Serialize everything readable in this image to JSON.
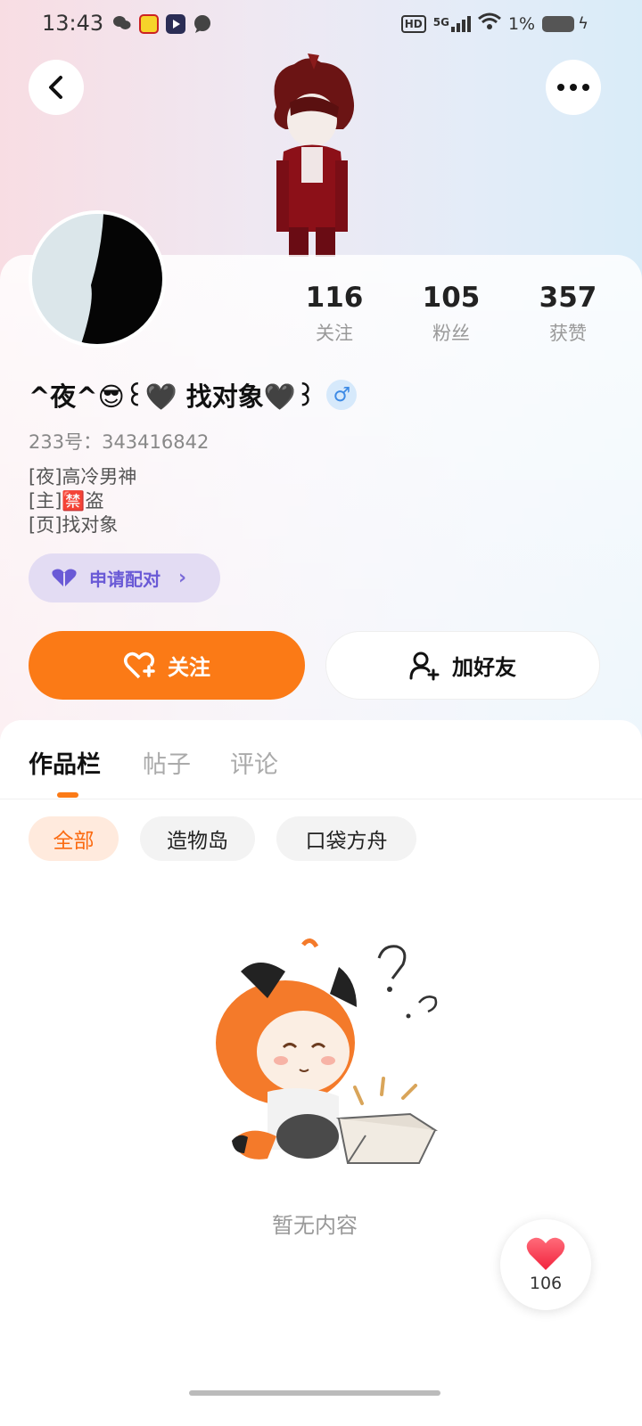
{
  "status_bar": {
    "time": "13:43",
    "network": "5G",
    "hd": "HD",
    "battery": "1%"
  },
  "profile": {
    "stats": [
      {
        "value": "116",
        "label": "关注"
      },
      {
        "value": "105",
        "label": "粉丝"
      },
      {
        "value": "357",
        "label": "获赞"
      }
    ],
    "nickname": "^夜^😎꒰🖤 找对象🖤꒱",
    "gender": "♂",
    "uid": "233号：343416842",
    "bio": [
      "[夜]高冷男神",
      "[主]🈲盗",
      "[页]找对象"
    ],
    "pair_button": "申请配对",
    "follow_button": "关注",
    "add_friend_button": "加好友"
  },
  "tabs": [
    "作品栏",
    "帖子",
    "评论"
  ],
  "filters": [
    "全部",
    "造物岛",
    "口袋方舟"
  ],
  "empty_text": "暂无内容",
  "like_count": "106",
  "colors": {
    "accent": "#fb7a16",
    "pair_purple": "#6a5ad6",
    "gender_blue": "#3d8ae5"
  }
}
